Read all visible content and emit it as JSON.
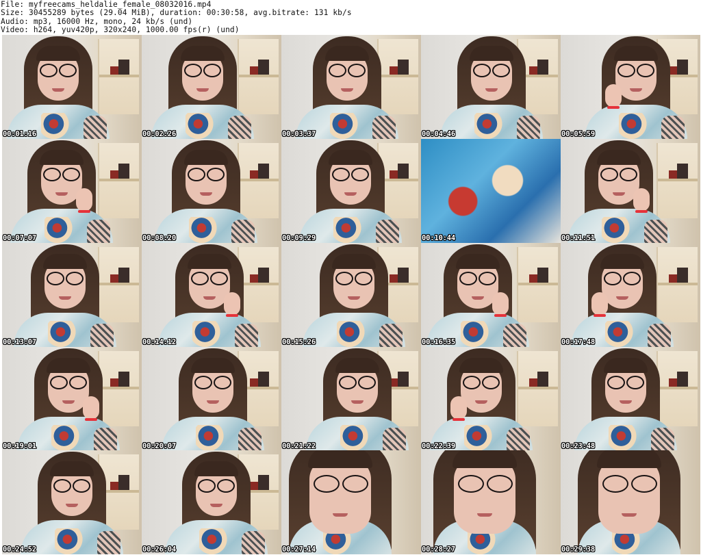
{
  "header": {
    "line1": "File: myfreecams_heldalie_female_08032016.mp4",
    "line2": "Size: 30455289 bytes (29.04 MiB), duration: 00:30:58, avg.bitrate: 131 kb/s",
    "line3": "Audio: mp3, 16000 Hz, mono, 24 kb/s (und)",
    "line4": "Video: h264, yuv420p, 320x240, 1000.00 fps(r) (und)"
  },
  "thumbnails": [
    {
      "time": "00:01:16",
      "kind": "person"
    },
    {
      "time": "00:02:26",
      "kind": "person"
    },
    {
      "time": "00:03:37",
      "kind": "person"
    },
    {
      "time": "00:04:46",
      "kind": "person"
    },
    {
      "time": "00:05:59",
      "kind": "person-hand"
    },
    {
      "time": "00:07:07",
      "kind": "person-hand"
    },
    {
      "time": "00:08:20",
      "kind": "person"
    },
    {
      "time": "00:09:29",
      "kind": "person"
    },
    {
      "time": "00:10:44",
      "kind": "shirt-close"
    },
    {
      "time": "00:11:51",
      "kind": "person-hand"
    },
    {
      "time": "00:13:07",
      "kind": "person"
    },
    {
      "time": "00:14:12",
      "kind": "person-hand"
    },
    {
      "time": "00:15:26",
      "kind": "person"
    },
    {
      "time": "00:16:35",
      "kind": "person-hand"
    },
    {
      "time": "00:17:48",
      "kind": "person-hand"
    },
    {
      "time": "00:19:01",
      "kind": "person-hand"
    },
    {
      "time": "00:20:07",
      "kind": "person"
    },
    {
      "time": "00:21:22",
      "kind": "person"
    },
    {
      "time": "00:22:39",
      "kind": "person-hand"
    },
    {
      "time": "00:23:48",
      "kind": "person"
    },
    {
      "time": "00:24:52",
      "kind": "person"
    },
    {
      "time": "00:26:04",
      "kind": "person"
    },
    {
      "time": "00:27:14",
      "kind": "closeup"
    },
    {
      "time": "00:28:27",
      "kind": "closeup"
    },
    {
      "time": "00:29:38",
      "kind": "closeup"
    }
  ]
}
